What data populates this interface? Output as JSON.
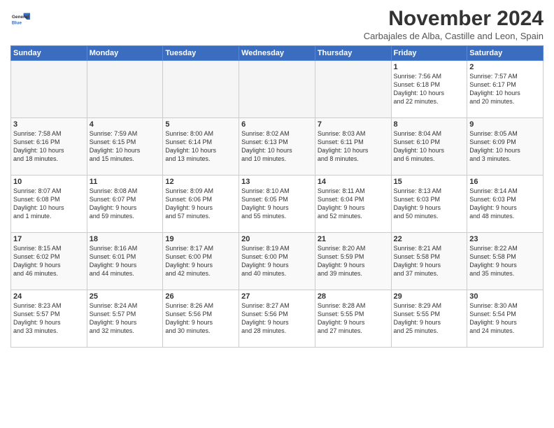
{
  "logo": {
    "line1": "General",
    "line2": "Blue"
  },
  "title": "November 2024",
  "subtitle": "Carbajales de Alba, Castille and Leon, Spain",
  "weekdays": [
    "Sunday",
    "Monday",
    "Tuesday",
    "Wednesday",
    "Thursday",
    "Friday",
    "Saturday"
  ],
  "weeks": [
    [
      {
        "day": "",
        "info": ""
      },
      {
        "day": "",
        "info": ""
      },
      {
        "day": "",
        "info": ""
      },
      {
        "day": "",
        "info": ""
      },
      {
        "day": "",
        "info": ""
      },
      {
        "day": "1",
        "info": "Sunrise: 7:56 AM\nSunset: 6:18 PM\nDaylight: 10 hours\nand 22 minutes."
      },
      {
        "day": "2",
        "info": "Sunrise: 7:57 AM\nSunset: 6:17 PM\nDaylight: 10 hours\nand 20 minutes."
      }
    ],
    [
      {
        "day": "3",
        "info": "Sunrise: 7:58 AM\nSunset: 6:16 PM\nDaylight: 10 hours\nand 18 minutes."
      },
      {
        "day": "4",
        "info": "Sunrise: 7:59 AM\nSunset: 6:15 PM\nDaylight: 10 hours\nand 15 minutes."
      },
      {
        "day": "5",
        "info": "Sunrise: 8:00 AM\nSunset: 6:14 PM\nDaylight: 10 hours\nand 13 minutes."
      },
      {
        "day": "6",
        "info": "Sunrise: 8:02 AM\nSunset: 6:13 PM\nDaylight: 10 hours\nand 10 minutes."
      },
      {
        "day": "7",
        "info": "Sunrise: 8:03 AM\nSunset: 6:11 PM\nDaylight: 10 hours\nand 8 minutes."
      },
      {
        "day": "8",
        "info": "Sunrise: 8:04 AM\nSunset: 6:10 PM\nDaylight: 10 hours\nand 6 minutes."
      },
      {
        "day": "9",
        "info": "Sunrise: 8:05 AM\nSunset: 6:09 PM\nDaylight: 10 hours\nand 3 minutes."
      }
    ],
    [
      {
        "day": "10",
        "info": "Sunrise: 8:07 AM\nSunset: 6:08 PM\nDaylight: 10 hours\nand 1 minute."
      },
      {
        "day": "11",
        "info": "Sunrise: 8:08 AM\nSunset: 6:07 PM\nDaylight: 9 hours\nand 59 minutes."
      },
      {
        "day": "12",
        "info": "Sunrise: 8:09 AM\nSunset: 6:06 PM\nDaylight: 9 hours\nand 57 minutes."
      },
      {
        "day": "13",
        "info": "Sunrise: 8:10 AM\nSunset: 6:05 PM\nDaylight: 9 hours\nand 55 minutes."
      },
      {
        "day": "14",
        "info": "Sunrise: 8:11 AM\nSunset: 6:04 PM\nDaylight: 9 hours\nand 52 minutes."
      },
      {
        "day": "15",
        "info": "Sunrise: 8:13 AM\nSunset: 6:03 PM\nDaylight: 9 hours\nand 50 minutes."
      },
      {
        "day": "16",
        "info": "Sunrise: 8:14 AM\nSunset: 6:03 PM\nDaylight: 9 hours\nand 48 minutes."
      }
    ],
    [
      {
        "day": "17",
        "info": "Sunrise: 8:15 AM\nSunset: 6:02 PM\nDaylight: 9 hours\nand 46 minutes."
      },
      {
        "day": "18",
        "info": "Sunrise: 8:16 AM\nSunset: 6:01 PM\nDaylight: 9 hours\nand 44 minutes."
      },
      {
        "day": "19",
        "info": "Sunrise: 8:17 AM\nSunset: 6:00 PM\nDaylight: 9 hours\nand 42 minutes."
      },
      {
        "day": "20",
        "info": "Sunrise: 8:19 AM\nSunset: 6:00 PM\nDaylight: 9 hours\nand 40 minutes."
      },
      {
        "day": "21",
        "info": "Sunrise: 8:20 AM\nSunset: 5:59 PM\nDaylight: 9 hours\nand 39 minutes."
      },
      {
        "day": "22",
        "info": "Sunrise: 8:21 AM\nSunset: 5:58 PM\nDaylight: 9 hours\nand 37 minutes."
      },
      {
        "day": "23",
        "info": "Sunrise: 8:22 AM\nSunset: 5:58 PM\nDaylight: 9 hours\nand 35 minutes."
      }
    ],
    [
      {
        "day": "24",
        "info": "Sunrise: 8:23 AM\nSunset: 5:57 PM\nDaylight: 9 hours\nand 33 minutes."
      },
      {
        "day": "25",
        "info": "Sunrise: 8:24 AM\nSunset: 5:57 PM\nDaylight: 9 hours\nand 32 minutes."
      },
      {
        "day": "26",
        "info": "Sunrise: 8:26 AM\nSunset: 5:56 PM\nDaylight: 9 hours\nand 30 minutes."
      },
      {
        "day": "27",
        "info": "Sunrise: 8:27 AM\nSunset: 5:56 PM\nDaylight: 9 hours\nand 28 minutes."
      },
      {
        "day": "28",
        "info": "Sunrise: 8:28 AM\nSunset: 5:55 PM\nDaylight: 9 hours\nand 27 minutes."
      },
      {
        "day": "29",
        "info": "Sunrise: 8:29 AM\nSunset: 5:55 PM\nDaylight: 9 hours\nand 25 minutes."
      },
      {
        "day": "30",
        "info": "Sunrise: 8:30 AM\nSunset: 5:54 PM\nDaylight: 9 hours\nand 24 minutes."
      }
    ]
  ]
}
